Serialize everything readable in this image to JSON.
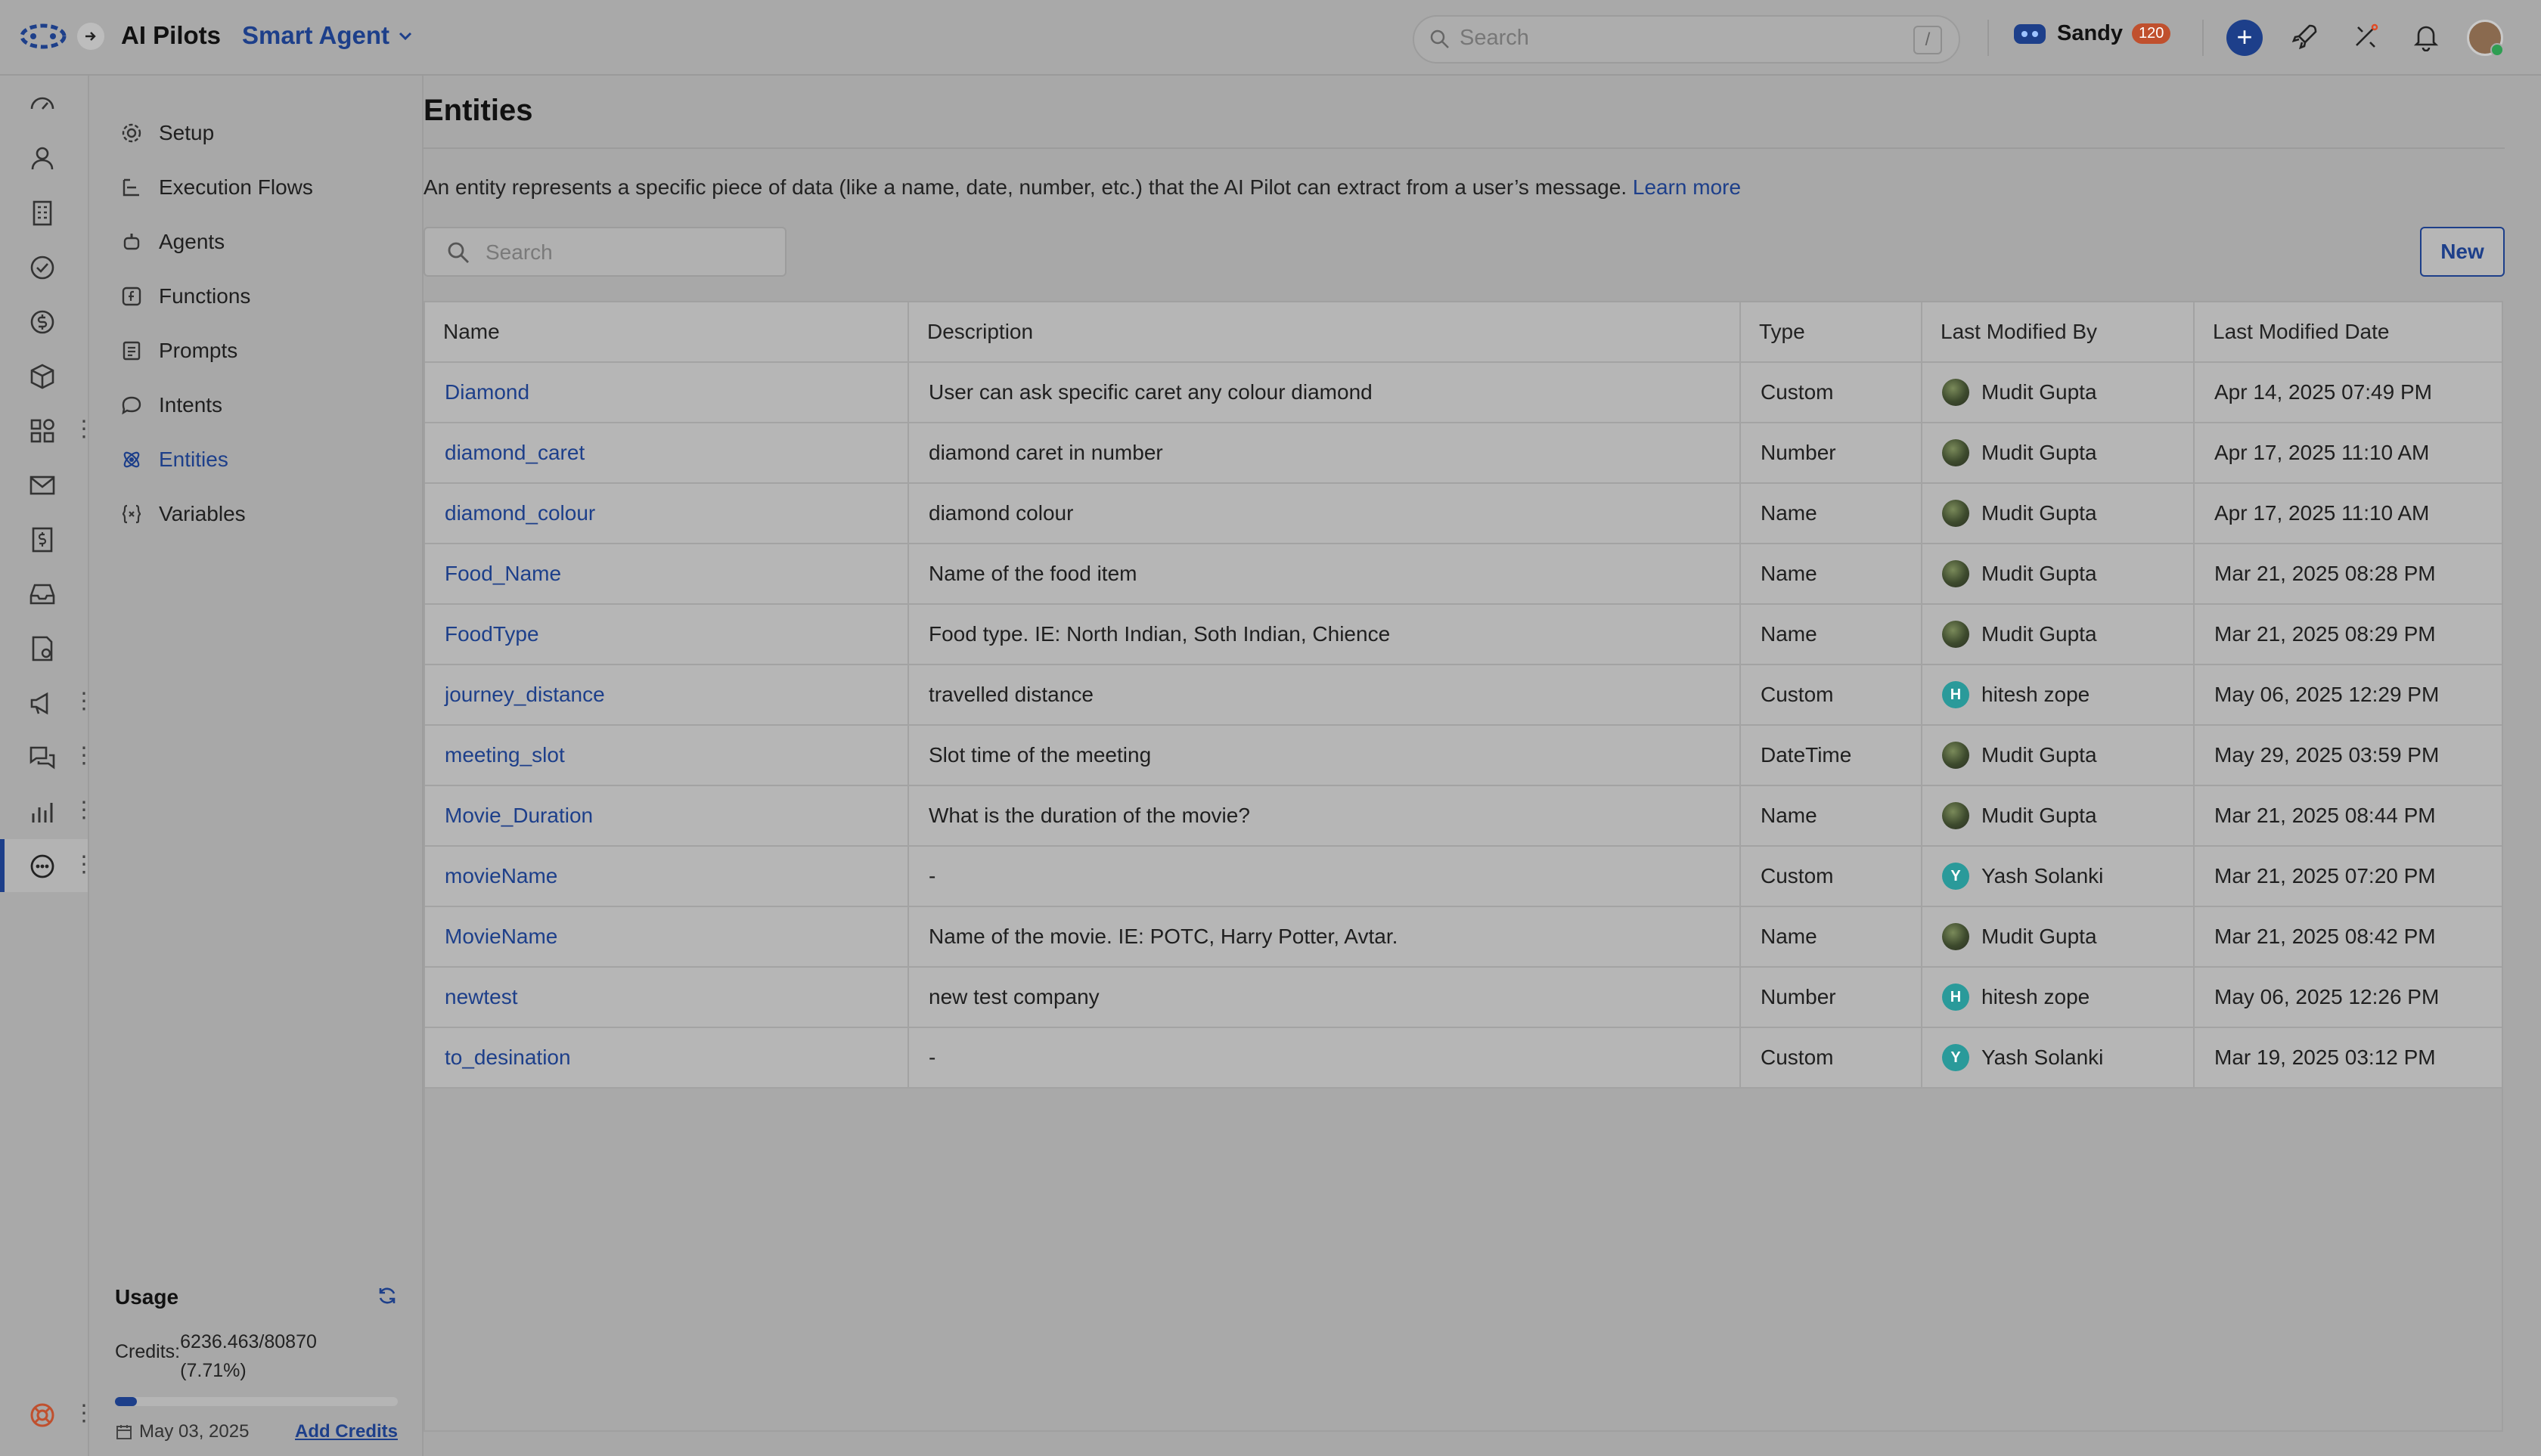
{
  "header": {
    "app_title": "AI Pilots",
    "agent_name": "Smart Agent",
    "search_placeholder": "Search",
    "search_shortcut": "/",
    "user_name": "Sandy",
    "user_badge": "120"
  },
  "rail": {
    "icons": [
      "dashboard-icon",
      "contacts-icon",
      "company-icon",
      "tasks-icon",
      "deals-icon",
      "products-icon",
      "apps-icon",
      "email-icon",
      "billing-icon",
      "inbox-icon",
      "forms-icon",
      "campaigns-icon",
      "chat-icon",
      "reports-icon",
      "ai-pilots-icon",
      "help-icon"
    ]
  },
  "sidenav": {
    "items": [
      {
        "label": "Setup",
        "icon": "gear-icon"
      },
      {
        "label": "Execution Flows",
        "icon": "flow-icon"
      },
      {
        "label": "Agents",
        "icon": "agent-icon"
      },
      {
        "label": "Functions",
        "icon": "function-icon"
      },
      {
        "label": "Prompts",
        "icon": "prompt-icon"
      },
      {
        "label": "Intents",
        "icon": "intent-icon"
      },
      {
        "label": "Entities",
        "icon": "entity-icon"
      },
      {
        "label": "Variables",
        "icon": "variable-icon"
      }
    ],
    "active": "Entities"
  },
  "usage": {
    "title": "Usage",
    "credits_label": "Credits:",
    "credits_value": "6236.463/80870",
    "credits_percent": "(7.71%)",
    "progress_fraction": 0.0771,
    "date": "May 03, 2025",
    "add_credits": "Add Credits"
  },
  "main": {
    "title": "Entities",
    "intro": "An entity represents a specific piece of data (like a name, date, number, etc.) that the AI Pilot can extract from a user’s message.",
    "learn_more": "Learn more",
    "search_placeholder": "Search",
    "new_button": "New"
  },
  "table": {
    "columns": [
      "Name",
      "Description",
      "Type",
      "Last Modified By",
      "Last Modified Date"
    ],
    "rows": [
      {
        "name": "Diamond",
        "description": "User can ask specific caret any colour diamond",
        "type": "Custom",
        "modified_by": "Mudit Gupta",
        "avatar": "photo",
        "date": "Apr 14, 2025 07:49 PM"
      },
      {
        "name": "diamond_caret",
        "description": "diamond caret in number",
        "type": "Number",
        "modified_by": "Mudit Gupta",
        "avatar": "photo",
        "date": "Apr 17, 2025 11:10 AM"
      },
      {
        "name": "diamond_colour",
        "description": "diamond colour",
        "type": "Name",
        "modified_by": "Mudit Gupta",
        "avatar": "photo",
        "date": "Apr 17, 2025 11:10 AM"
      },
      {
        "name": "Food_Name",
        "description": "Name of the food item",
        "type": "Name",
        "modified_by": "Mudit Gupta",
        "avatar": "photo",
        "date": "Mar 21, 2025 08:28 PM"
      },
      {
        "name": "FoodType",
        "description": "Food type. IE: North Indian, Soth Indian, Chience",
        "type": "Name",
        "modified_by": "Mudit Gupta",
        "avatar": "photo",
        "date": "Mar 21, 2025 08:29 PM"
      },
      {
        "name": "journey_distance",
        "description": "travelled distance",
        "type": "Custom",
        "modified_by": "hitesh zope",
        "avatar": "H",
        "date": "May 06, 2025 12:29 PM"
      },
      {
        "name": "meeting_slot",
        "description": "Slot time of the meeting",
        "type": "DateTime",
        "modified_by": "Mudit Gupta",
        "avatar": "photo",
        "date": "May 29, 2025 03:59 PM"
      },
      {
        "name": "Movie_Duration",
        "description": "What is the duration of the movie?",
        "type": "Name",
        "modified_by": "Mudit Gupta",
        "avatar": "photo",
        "date": "Mar 21, 2025 08:44 PM"
      },
      {
        "name": "movieName",
        "description": "-",
        "type": "Custom",
        "modified_by": "Yash Solanki",
        "avatar": "Y",
        "date": "Mar 21, 2025 07:20 PM"
      },
      {
        "name": "MovieName",
        "description": "Name of the movie. IE: POTC, Harry Potter, Avtar.",
        "type": "Name",
        "modified_by": "Mudit Gupta",
        "avatar": "photo",
        "date": "Mar 21, 2025 08:42 PM"
      },
      {
        "name": "newtest",
        "description": "new test company",
        "type": "Number",
        "modified_by": "hitesh zope",
        "avatar": "H",
        "date": "May 06, 2025 12:26 PM"
      },
      {
        "name": "to_desination",
        "description": "-",
        "type": "Custom",
        "modified_by": "Yash Solanki",
        "avatar": "Y",
        "date": "Mar 19, 2025 03:12 PM"
      }
    ]
  },
  "colors": {
    "accent": "#1d3f8a",
    "highlight": "#e04a25",
    "badge": "#c0502e",
    "avatar_teal": "#2a9a9a"
  }
}
